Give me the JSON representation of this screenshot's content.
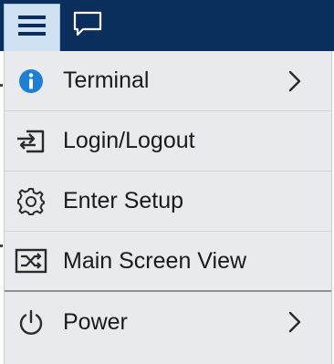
{
  "topbar": {
    "menu_icon": "hamburger-menu-icon",
    "chat_icon": "chat-bubble-icon",
    "background_color": "#0a2f5c",
    "active_tab_color": "#cfe2f2"
  },
  "menu": {
    "items": [
      {
        "label": "Terminal",
        "icon": "info-icon",
        "has_submenu": true
      },
      {
        "label": "Login/Logout",
        "icon": "login-logout-icon",
        "has_submenu": false
      },
      {
        "label": "Enter Setup",
        "icon": "gear-icon",
        "has_submenu": false
      },
      {
        "label": "Main Screen View",
        "icon": "shuffle-screen-icon",
        "has_submenu": false
      },
      {
        "label": "Power",
        "icon": "power-icon",
        "has_submenu": true
      }
    ],
    "info_icon_color": "#1e7fd6"
  }
}
